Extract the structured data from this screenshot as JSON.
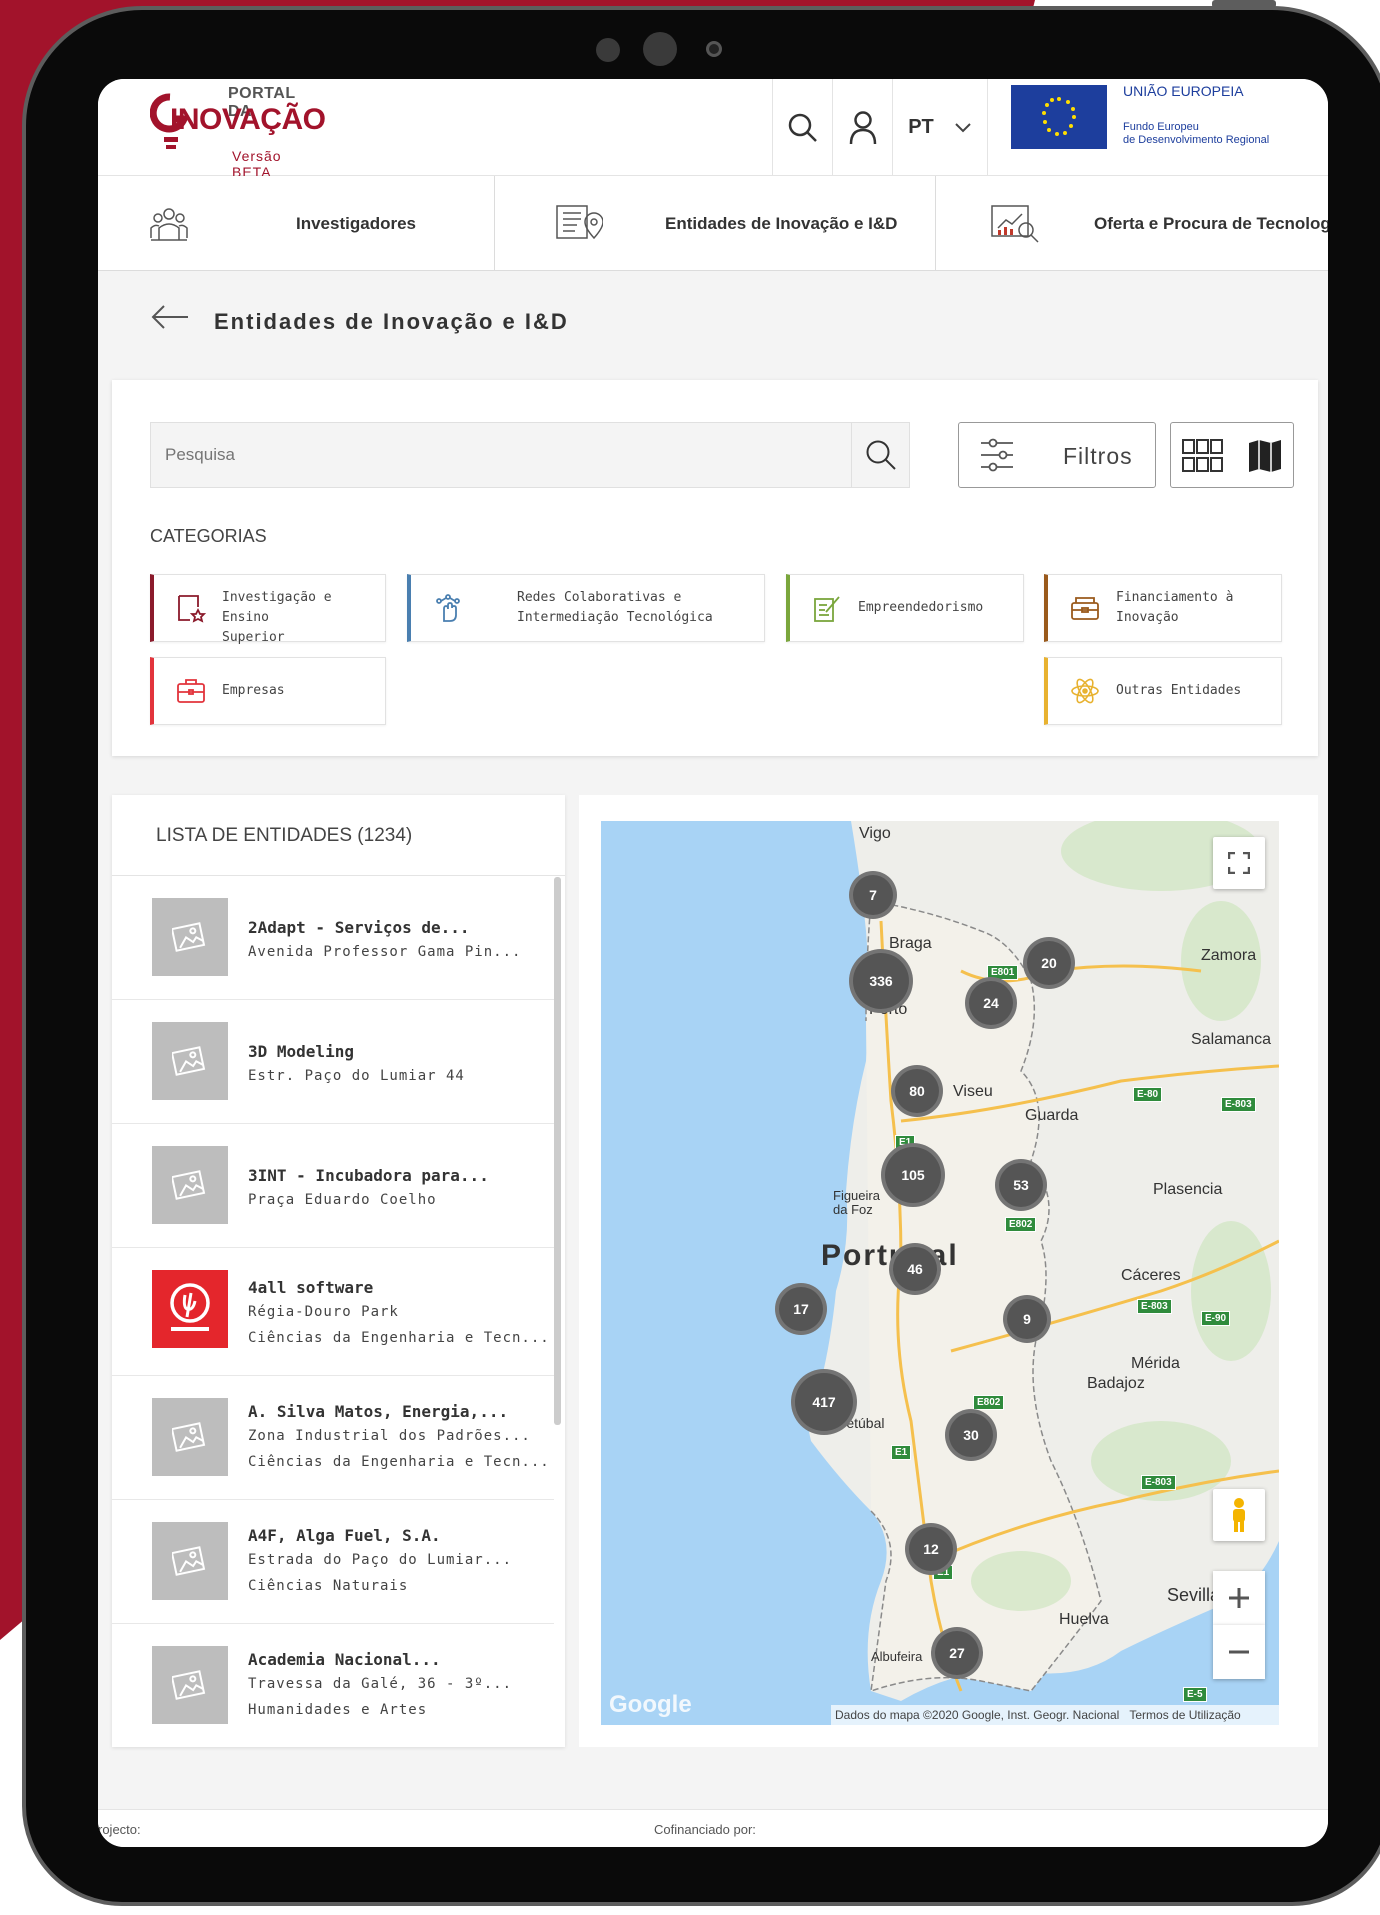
{
  "header": {
    "logo_top": "PORTAL DA",
    "logo_main": "INOVAÇÃO",
    "logo_beta": "Versão BETA",
    "language": "PT",
    "eu_title": "UNIÃO EUROPEIA",
    "eu_sub_1": "Fundo Europeu",
    "eu_sub_2": "de Desenvolvimento Regional"
  },
  "nav": {
    "items": [
      {
        "label": "Investigadores",
        "icon": "researchers-icon"
      },
      {
        "label": "Entidades de Inovação e I&D",
        "icon": "map-document-icon"
      },
      {
        "label": "Oferta e Procura de Tecnologia",
        "icon": "analytics-search-icon"
      }
    ]
  },
  "page": {
    "title": "Entidades de Inovação e I&D"
  },
  "search": {
    "placeholder": "Pesquisa",
    "filters_label": "Filtros"
  },
  "categories": {
    "title": "CATEGORIAS",
    "items": [
      {
        "line1": "Investigação e Ensino",
        "line2": "Superior",
        "color": "#8b1a2b"
      },
      {
        "line1": "Redes Colaborativas e",
        "line2": "Intermediação Tecnológica",
        "color": "#4a7fb0"
      },
      {
        "line1": "Empreendedorismo",
        "line2": "",
        "color": "#7aa63c"
      },
      {
        "line1": "Financiamento à",
        "line2": "Inovação",
        "color": "#9a5a1c"
      },
      {
        "line1": "Empresas",
        "line2": "",
        "color": "#e2343c"
      },
      {
        "line1": "Outras Entidades",
        "line2": "",
        "color": "#e8b230"
      }
    ]
  },
  "list": {
    "title": "LISTA DE ENTIDADES (1234)",
    "items": [
      {
        "name": "2Adapt - Serviços de...",
        "line1": "Avenida Professor Gama Pin...",
        "line2": ""
      },
      {
        "name": "3D Modeling",
        "line1": "Estr. Paço do Lumiar 44",
        "line2": ""
      },
      {
        "name": "3INT - Incubadora para...",
        "line1": "Praça Eduardo Coelho",
        "line2": ""
      },
      {
        "name": "4all software",
        "line1": "Régia-Douro Park",
        "line2": "Ciências da Engenharia e Tecn..."
      },
      {
        "name": "A. Silva Matos, Energia,...",
        "line1": "Zona Industrial dos Padrões...",
        "line2": "Ciências da Engenharia e Tecn..."
      },
      {
        "name": "A4F, Alga Fuel, S.A.",
        "line1": "Estrada do Paço do Lumiar...",
        "line2": "Ciências Naturais"
      },
      {
        "name": "Academia Nacional...",
        "line1": "Travessa da Galé, 36 - 3º...",
        "line2": "Humanidades e Artes"
      }
    ]
  },
  "map": {
    "country_label": "Portugal",
    "cities": [
      "Vigo",
      "Braga",
      "Porto",
      "Zamora",
      "Salamanca",
      "Viseu",
      "Guarda",
      "Figueira da Foz",
      "Plasencia",
      "Cáceres",
      "Mérida",
      "Badajoz",
      "Setúbal",
      "Huelva",
      "Sevilla",
      "Albufeira"
    ],
    "clusters": [
      7,
      336,
      20,
      24,
      80,
      105,
      53,
      46,
      17,
      9,
      417,
      30,
      12,
      27
    ],
    "roads": [
      "E801",
      "E-80",
      "E-803",
      "E1",
      "E802",
      "E-803",
      "E-90",
      "E802",
      "E1",
      "E-803",
      "E1",
      "E-5"
    ],
    "credit": "Dados do mapa ©2020 Google, Inst. Geogr. Nacional",
    "terms": "Termos de Utilização",
    "google": "Google"
  },
  "footer": {
    "project": "rojecto:",
    "cofinanced": "Cofinanciado por:"
  }
}
